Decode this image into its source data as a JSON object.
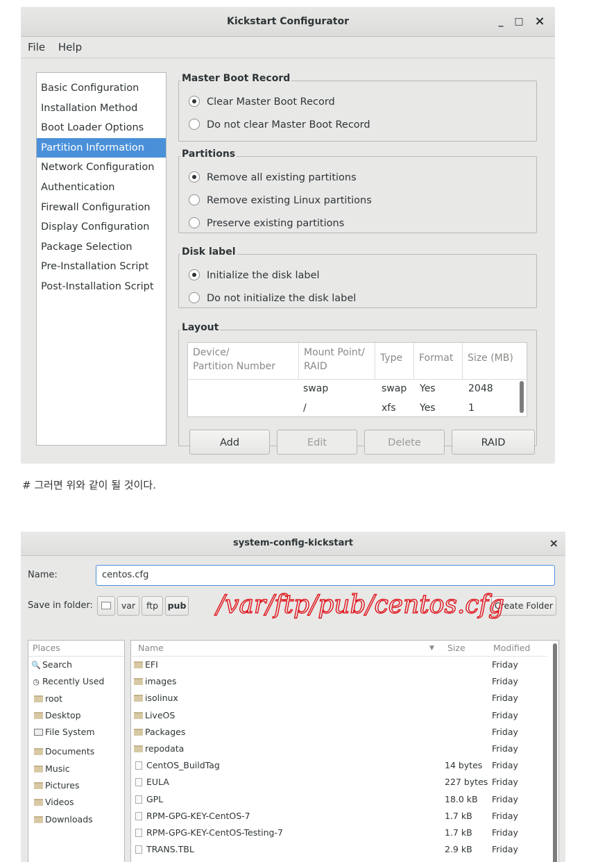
{
  "kickstart": {
    "title": "Kickstart Configurator",
    "controls": {
      "minimize": "_",
      "maximize": "□",
      "close": "×"
    },
    "menu": [
      "File",
      "Help"
    ],
    "nav": [
      "Basic Configuration",
      "Installation Method",
      "Boot Loader Options",
      "Partition Information",
      "Network Configuration",
      "Authentication",
      "Firewall Configuration",
      "Display Configuration",
      "Package Selection",
      "Pre-Installation Script",
      "Post-Installation Script"
    ],
    "mbr": {
      "title": "Master Boot Record",
      "options": [
        "Clear Master Boot Record",
        "Do not clear Master Boot Record"
      ]
    },
    "partitions": {
      "title": "Partitions",
      "options": [
        "Remove all existing partitions",
        "Remove existing Linux partitions",
        "Preserve existing partitions"
      ]
    },
    "disklabel": {
      "title": "Disk label",
      "options": [
        "Initialize the disk label",
        "Do not initialize the disk label"
      ]
    },
    "layout": {
      "title": "Layout",
      "columns": [
        "Device/\nPartition Number",
        "Mount Point/\nRAID",
        "Type",
        "Format",
        "Size (MB)"
      ],
      "rows": [
        [
          "",
          "swap",
          "swap",
          "Yes",
          "2048"
        ],
        [
          "",
          "/",
          "xfs",
          "Yes",
          "1"
        ]
      ],
      "buttons": [
        "Add",
        "Edit",
        "Delete",
        "RAID"
      ]
    }
  },
  "caption": "# 그러면 위와 같이 될 것이다.",
  "save_dialog": {
    "title": "system-config-kickstart",
    "close": "×",
    "name_label": "Name:",
    "name_value": "centos.cfg",
    "folder_label": "Save in folder:",
    "path": [
      "var",
      "ftp",
      "pub"
    ],
    "create_folder": "Create Folder",
    "places_header": "Places",
    "places": [
      {
        "label": "Search",
        "icon": "search-icon"
      },
      {
        "label": "Recently Used",
        "icon": "clock-icon"
      },
      {
        "label": "root",
        "icon": "folder-icon"
      },
      {
        "label": "Desktop",
        "icon": "folder-icon"
      },
      {
        "label": "File System",
        "icon": "drive-icon"
      },
      {
        "label": "Documents",
        "icon": "folder-icon"
      },
      {
        "label": "Music",
        "icon": "folder-icon"
      },
      {
        "label": "Pictures",
        "icon": "folder-icon"
      },
      {
        "label": "Videos",
        "icon": "folder-icon"
      },
      {
        "label": "Downloads",
        "icon": "folder-icon"
      }
    ],
    "columns": {
      "name": "Name",
      "size": "Size",
      "modified": "Modified"
    },
    "files": [
      {
        "name": "EFI",
        "size": "",
        "modified": "Friday",
        "type": "folder"
      },
      {
        "name": "images",
        "size": "",
        "modified": "Friday",
        "type": "folder"
      },
      {
        "name": "isolinux",
        "size": "",
        "modified": "Friday",
        "type": "folder"
      },
      {
        "name": "LiveOS",
        "size": "",
        "modified": "Friday",
        "type": "folder"
      },
      {
        "name": "Packages",
        "size": "",
        "modified": "Friday",
        "type": "folder"
      },
      {
        "name": "repodata",
        "size": "",
        "modified": "Friday",
        "type": "folder"
      },
      {
        "name": "CentOS_BuildTag",
        "size": "14 bytes",
        "modified": "Friday",
        "type": "file"
      },
      {
        "name": "EULA",
        "size": "227 bytes",
        "modified": "Friday",
        "type": "file"
      },
      {
        "name": "GPL",
        "size": "18.0 kB",
        "modified": "Friday",
        "type": "file"
      },
      {
        "name": "RPM-GPG-KEY-CentOS-7",
        "size": "1.7 kB",
        "modified": "Friday",
        "type": "file"
      },
      {
        "name": "RPM-GPG-KEY-CentOS-Testing-7",
        "size": "1.7 kB",
        "modified": "Friday",
        "type": "file"
      },
      {
        "name": "TRANS.TBL",
        "size": "2.9 kB",
        "modified": "Friday",
        "type": "file"
      }
    ],
    "annotation": "/var/ftp/pub/centos.cfg"
  }
}
